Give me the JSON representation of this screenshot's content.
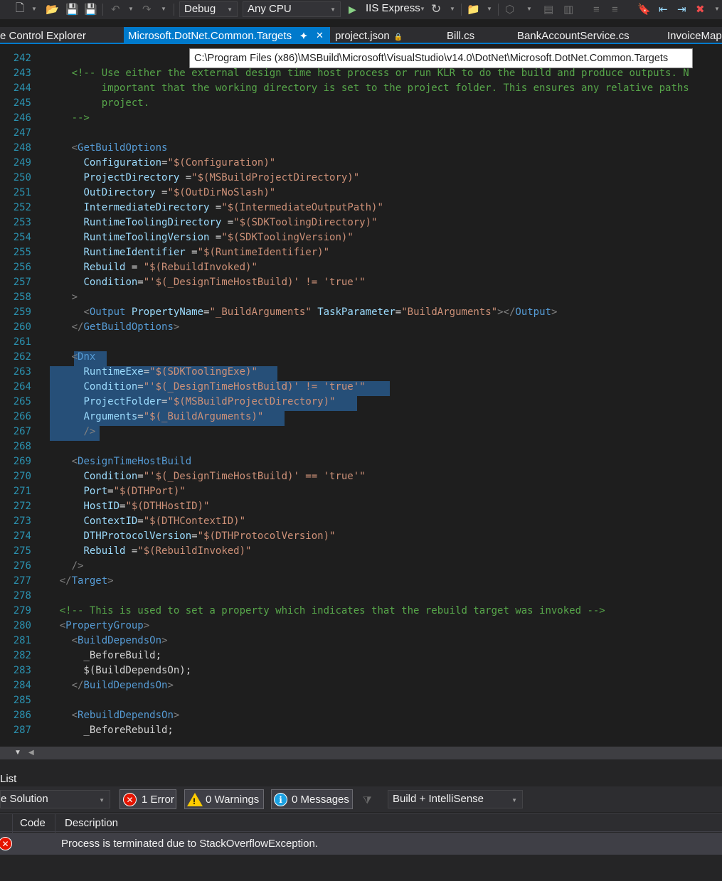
{
  "toolbar": {
    "config": "Debug",
    "platform": "Any CPU",
    "run_target": "IIS Express"
  },
  "tabs": [
    {
      "label": "e Control Explorer",
      "active": false
    },
    {
      "label": "Microsoft.DotNet.Common.Targets",
      "active": true
    },
    {
      "label": "project.json",
      "active": false
    },
    {
      "label": "Bill.cs",
      "active": false
    },
    {
      "label": "BankAccountService.cs",
      "active": false
    },
    {
      "label": "InvoiceMap",
      "active": false
    }
  ],
  "tooltip": "C:\\Program Files (x86)\\MSBuild\\Microsoft\\VisualStudio\\v14.0\\DotNet\\Microsoft.DotNet.Common.Targets",
  "code_lines": [
    {
      "n": "242",
      "tokens": []
    },
    {
      "n": "243",
      "tokens": [
        [
          "t",
          "      "
        ],
        [
          "c",
          "<!-- Use either the external design time host process or run KLR to do the build and produce outputs. N"
        ]
      ]
    },
    {
      "n": "244",
      "tokens": [
        [
          "c",
          "           important that the working directory is set to the project folder. This ensures any relative paths"
        ]
      ]
    },
    {
      "n": "245",
      "tokens": [
        [
          "c",
          "           project."
        ]
      ]
    },
    {
      "n": "246",
      "tokens": [
        [
          "c",
          "      -->"
        ]
      ]
    },
    {
      "n": "247",
      "tokens": []
    },
    {
      "n": "248",
      "tokens": [
        [
          "t",
          "      "
        ],
        [
          "l",
          "<"
        ],
        [
          "g",
          "GetBuildOptions"
        ]
      ]
    },
    {
      "n": "249",
      "tokens": [
        [
          "t",
          "        "
        ],
        [
          "a",
          "Configuration"
        ],
        [
          "t",
          "="
        ],
        [
          "v",
          "\"$(Configuration)\""
        ]
      ]
    },
    {
      "n": "250",
      "tokens": [
        [
          "t",
          "        "
        ],
        [
          "a",
          "ProjectDirectory"
        ],
        [
          "t",
          " ="
        ],
        [
          "v",
          "\"$(MSBuildProjectDirectory)\""
        ]
      ]
    },
    {
      "n": "251",
      "tokens": [
        [
          "t",
          "        "
        ],
        [
          "a",
          "OutDirectory"
        ],
        [
          "t",
          " ="
        ],
        [
          "v",
          "\"$(OutDirNoSlash)\""
        ]
      ]
    },
    {
      "n": "252",
      "tokens": [
        [
          "t",
          "        "
        ],
        [
          "a",
          "IntermediateDirectory"
        ],
        [
          "t",
          " ="
        ],
        [
          "v",
          "\"$(IntermediateOutputPath)\""
        ]
      ]
    },
    {
      "n": "253",
      "tokens": [
        [
          "t",
          "        "
        ],
        [
          "a",
          "RuntimeToolingDirectory"
        ],
        [
          "t",
          " ="
        ],
        [
          "v",
          "\"$(SDKToolingDirectory)\""
        ]
      ]
    },
    {
      "n": "254",
      "tokens": [
        [
          "t",
          "        "
        ],
        [
          "a",
          "RuntimeToolingVersion"
        ],
        [
          "t",
          " ="
        ],
        [
          "v",
          "\"$(SDKToolingVersion)\""
        ]
      ]
    },
    {
      "n": "255",
      "tokens": [
        [
          "t",
          "        "
        ],
        [
          "a",
          "RuntimeIdentifier"
        ],
        [
          "t",
          " ="
        ],
        [
          "v",
          "\"$(RuntimeIdentifier)\""
        ]
      ]
    },
    {
      "n": "256",
      "tokens": [
        [
          "t",
          "        "
        ],
        [
          "a",
          "Rebuild"
        ],
        [
          "t",
          " = "
        ],
        [
          "v",
          "\"$(RebuildInvoked)\""
        ]
      ]
    },
    {
      "n": "257",
      "tokens": [
        [
          "t",
          "        "
        ],
        [
          "a",
          "Condition"
        ],
        [
          "t",
          "="
        ],
        [
          "v",
          "\"'$(_DesignTimeHostBuild)' != 'true'\""
        ]
      ]
    },
    {
      "n": "258",
      "tokens": [
        [
          "t",
          "      "
        ],
        [
          "l",
          ">"
        ]
      ]
    },
    {
      "n": "259",
      "tokens": [
        [
          "t",
          "        "
        ],
        [
          "l",
          "<"
        ],
        [
          "g",
          "Output"
        ],
        [
          "t",
          " "
        ],
        [
          "a",
          "PropertyName"
        ],
        [
          "t",
          "="
        ],
        [
          "v",
          "\"_BuildArguments\""
        ],
        [
          "t",
          " "
        ],
        [
          "a",
          "TaskParameter"
        ],
        [
          "t",
          "="
        ],
        [
          "v",
          "\"BuildArguments\""
        ],
        [
          "l",
          "></"
        ],
        [
          "g",
          "Output"
        ],
        [
          "l",
          ">"
        ]
      ]
    },
    {
      "n": "260",
      "tokens": [
        [
          "t",
          "      "
        ],
        [
          "l",
          "</"
        ],
        [
          "g",
          "GetBuildOptions"
        ],
        [
          "l",
          ">"
        ]
      ]
    },
    {
      "n": "261",
      "tokens": []
    },
    {
      "n": "262",
      "tokens": [
        [
          "t",
          "      "
        ],
        [
          "l",
          "<"
        ],
        [
          "g",
          "Dnx"
        ]
      ]
    },
    {
      "n": "263",
      "tokens": [
        [
          "t",
          "        "
        ],
        [
          "a",
          "RuntimeExe"
        ],
        [
          "t",
          "="
        ],
        [
          "v",
          "\"$(SDKToolingExe)\""
        ]
      ]
    },
    {
      "n": "264",
      "tokens": [
        [
          "t",
          "        "
        ],
        [
          "a",
          "Condition"
        ],
        [
          "t",
          "="
        ],
        [
          "v",
          "\"'$(_DesignTimeHostBuild)' != 'true'\""
        ]
      ]
    },
    {
      "n": "265",
      "tokens": [
        [
          "t",
          "        "
        ],
        [
          "a",
          "ProjectFolder"
        ],
        [
          "t",
          "="
        ],
        [
          "v",
          "\"$(MSBuildProjectDirectory)\""
        ]
      ]
    },
    {
      "n": "266",
      "tokens": [
        [
          "t",
          "        "
        ],
        [
          "a",
          "Arguments"
        ],
        [
          "t",
          "="
        ],
        [
          "v",
          "\"$(_BuildArguments)\""
        ]
      ]
    },
    {
      "n": "267",
      "tokens": [
        [
          "t",
          "        "
        ],
        [
          "l",
          "/>"
        ]
      ]
    },
    {
      "n": "268",
      "tokens": []
    },
    {
      "n": "269",
      "tokens": [
        [
          "t",
          "      "
        ],
        [
          "l",
          "<"
        ],
        [
          "g",
          "DesignTimeHostBuild"
        ]
      ]
    },
    {
      "n": "270",
      "tokens": [
        [
          "t",
          "        "
        ],
        [
          "a",
          "Condition"
        ],
        [
          "t",
          "="
        ],
        [
          "v",
          "\"'$(_DesignTimeHostBuild)' == 'true'\""
        ]
      ]
    },
    {
      "n": "271",
      "tokens": [
        [
          "t",
          "        "
        ],
        [
          "a",
          "Port"
        ],
        [
          "t",
          "="
        ],
        [
          "v",
          "\"$(DTHPort)\""
        ]
      ]
    },
    {
      "n": "272",
      "tokens": [
        [
          "t",
          "        "
        ],
        [
          "a",
          "HostID"
        ],
        [
          "t",
          "="
        ],
        [
          "v",
          "\"$(DTHHostID)\""
        ]
      ]
    },
    {
      "n": "273",
      "tokens": [
        [
          "t",
          "        "
        ],
        [
          "a",
          "ContextID"
        ],
        [
          "t",
          "="
        ],
        [
          "v",
          "\"$(DTHContextID)\""
        ]
      ]
    },
    {
      "n": "274",
      "tokens": [
        [
          "t",
          "        "
        ],
        [
          "a",
          "DTHProtocolVersion"
        ],
        [
          "t",
          "="
        ],
        [
          "v",
          "\"$(DTHProtocolVersion)\""
        ]
      ]
    },
    {
      "n": "275",
      "tokens": [
        [
          "t",
          "        "
        ],
        [
          "a",
          "Rebuild"
        ],
        [
          "t",
          " ="
        ],
        [
          "v",
          "\"$(RebuildInvoked)\""
        ]
      ]
    },
    {
      "n": "276",
      "tokens": [
        [
          "t",
          "      "
        ],
        [
          "l",
          "/>"
        ]
      ]
    },
    {
      "n": "277",
      "tokens": [
        [
          "t",
          "    "
        ],
        [
          "l",
          "</"
        ],
        [
          "g",
          "Target"
        ],
        [
          "l",
          ">"
        ]
      ]
    },
    {
      "n": "278",
      "tokens": []
    },
    {
      "n": "279",
      "tokens": [
        [
          "t",
          "    "
        ],
        [
          "c",
          "<!-- This is used to set a property which indicates that the rebuild target was invoked -->"
        ]
      ]
    },
    {
      "n": "280",
      "tokens": [
        [
          "t",
          "    "
        ],
        [
          "l",
          "<"
        ],
        [
          "g",
          "PropertyGroup"
        ],
        [
          "l",
          ">"
        ]
      ]
    },
    {
      "n": "281",
      "tokens": [
        [
          "t",
          "      "
        ],
        [
          "l",
          "<"
        ],
        [
          "g",
          "BuildDependsOn"
        ],
        [
          "l",
          ">"
        ]
      ]
    },
    {
      "n": "282",
      "tokens": [
        [
          "t",
          "        _BeforeBuild;"
        ]
      ]
    },
    {
      "n": "283",
      "tokens": [
        [
          "t",
          "        $(BuildDependsOn);"
        ]
      ]
    },
    {
      "n": "284",
      "tokens": [
        [
          "t",
          "      "
        ],
        [
          "l",
          "</"
        ],
        [
          "g",
          "BuildDependsOn"
        ],
        [
          "l",
          ">"
        ]
      ]
    },
    {
      "n": "285",
      "tokens": []
    },
    {
      "n": "286",
      "tokens": [
        [
          "t",
          "      "
        ],
        [
          "l",
          "<"
        ],
        [
          "g",
          "RebuildDependsOn"
        ],
        [
          "l",
          ">"
        ]
      ]
    },
    {
      "n": "287",
      "tokens": [
        [
          "t",
          "        _BeforeRebuild;"
        ]
      ]
    }
  ],
  "error_list": {
    "title": "List",
    "scope": "e Solution",
    "errors_label": "1 Error",
    "warnings_label": "0 Warnings",
    "messages_label": "0 Messages",
    "build_filter": "Build + IntelliSense",
    "columns": {
      "code": "Code",
      "description": "Description"
    },
    "rows": [
      {
        "code": "",
        "description": "Process is terminated due to StackOverflowException."
      }
    ]
  },
  "colors": {
    "accent": "#007acc",
    "selection": "#264f78",
    "line_number": "#2b91af",
    "tag": "#569cd6",
    "attr": "#9cdcfe",
    "value": "#ce9178",
    "comment": "#57a64a",
    "error": "#e51400"
  }
}
